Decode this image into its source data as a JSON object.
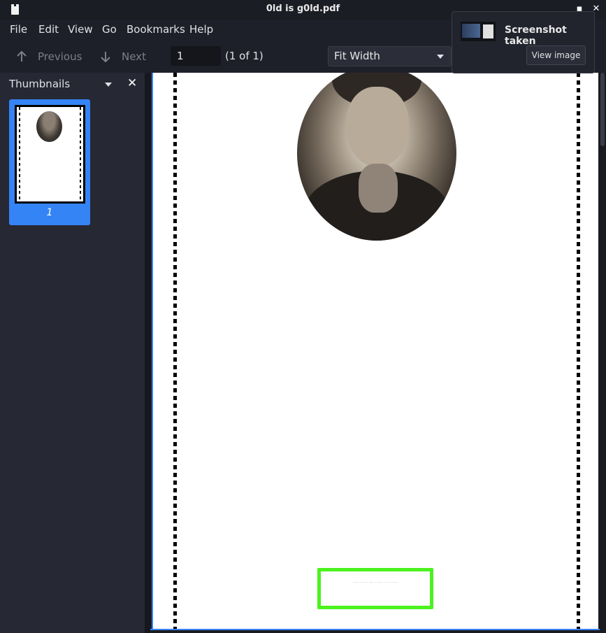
{
  "window": {
    "title": "0ld is g0ld.pdf"
  },
  "menu": [
    "File",
    "Edit",
    "View",
    "Go",
    "Bookmarks",
    "Help"
  ],
  "toolbar": {
    "previous_label": "Previous",
    "next_label": "Next",
    "page_input_value": "1",
    "page_count": "(1 of 1)",
    "zoom_value": "Fit Width"
  },
  "sidebar": {
    "header": "Thumbnails",
    "thumbnails": [
      {
        "page_label": "1"
      }
    ]
  },
  "notification": {
    "title": "Screenshot taken",
    "button_label": "View image"
  },
  "colors": {
    "accent": "#3584f6",
    "highlight_box": "#4cf21f",
    "background": "#1e2029"
  }
}
